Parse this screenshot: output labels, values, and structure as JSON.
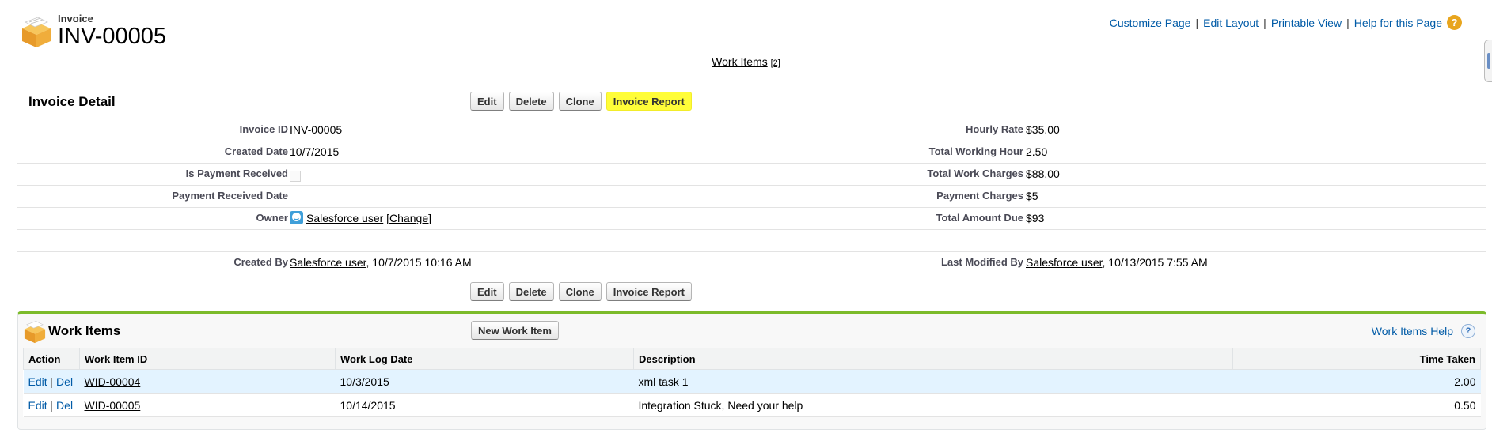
{
  "header": {
    "object_type": "Invoice",
    "record_name": "INV-00005",
    "links": [
      "Customize Page",
      "Edit Layout",
      "Printable View",
      "Help for this Page"
    ],
    "separator": "|",
    "help_icon_glyph": "?"
  },
  "related_link": {
    "label": "Work Items",
    "count": "[2]"
  },
  "detail": {
    "title": "Invoice Detail",
    "buttons": {
      "edit": "Edit",
      "delete": "Delete",
      "clone": "Clone",
      "invoice_report": "Invoice Report"
    },
    "highlight_color": "#fffd38",
    "fields": {
      "invoice_id": {
        "label": "Invoice ID",
        "value": "INV-00005"
      },
      "created_date": {
        "label": "Created Date",
        "value": "10/7/2015"
      },
      "is_payment_received": {
        "label": "Is Payment Received",
        "value": false
      },
      "payment_received_date": {
        "label": "Payment Received Date",
        "value": ""
      },
      "owner": {
        "label": "Owner",
        "name": "Salesforce user",
        "change": "[Change]"
      },
      "hourly_rate": {
        "label": "Hourly Rate",
        "value": "$35.00"
      },
      "total_working_hour": {
        "label": "Total Working Hour",
        "value": "2.50"
      },
      "total_work_charges": {
        "label": "Total Work Charges",
        "value": "$88.00"
      },
      "payment_charges": {
        "label": "Payment Charges",
        "value": "$5"
      },
      "total_amount_due": {
        "label": "Total Amount Due",
        "value": "$93"
      },
      "created_by": {
        "label": "Created By",
        "user": "Salesforce user",
        "stamp": ", 10/7/2015 10:16 AM"
      },
      "last_modified_by": {
        "label": "Last Modified By",
        "user": "Salesforce user",
        "stamp": ", 10/13/2015 7:55 AM"
      }
    }
  },
  "work_items": {
    "title": "Work Items",
    "new_button": "New Work Item",
    "help_link": "Work Items Help",
    "help_icon_glyph": "?",
    "columns": [
      "Action",
      "Work Item ID",
      "Work Log Date",
      "Description",
      "Time Taken"
    ],
    "action_edit": "Edit",
    "action_sep": "|",
    "action_del": "Del",
    "rows": [
      {
        "id": "WID-00004",
        "date": "10/3/2015",
        "description": "xml task 1",
        "time": "2.00"
      },
      {
        "id": "WID-00005",
        "date": "10/14/2015",
        "description": "Integration Stuck, Need your help",
        "time": "0.50"
      }
    ],
    "accent_color": "#7cbb2a"
  }
}
